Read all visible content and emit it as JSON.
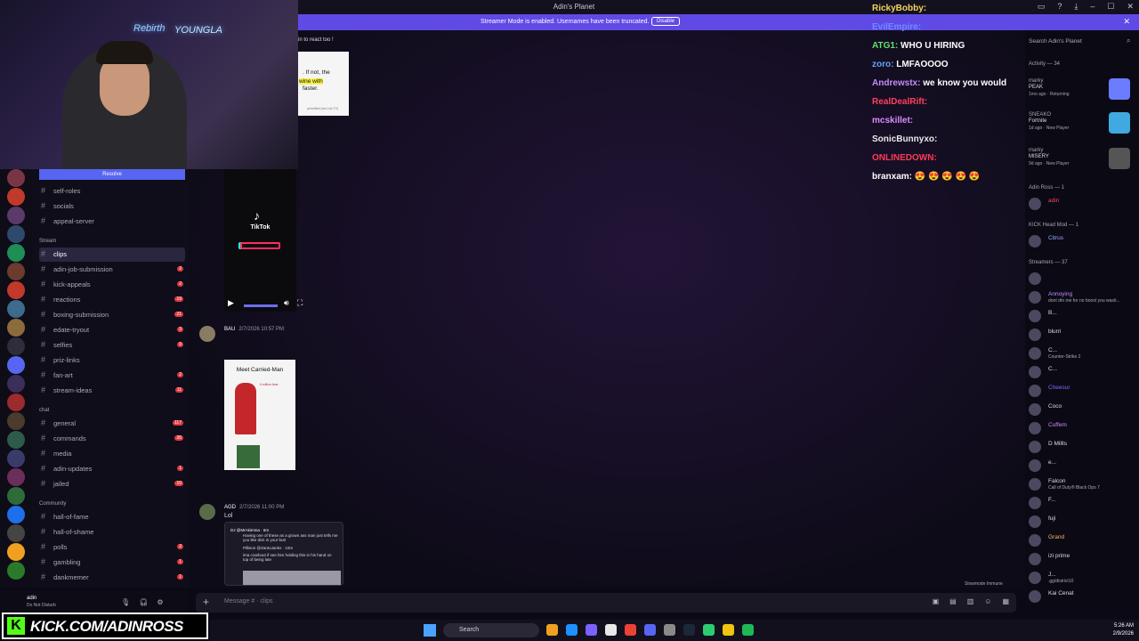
{
  "window": {
    "title": "Adin's Planet"
  },
  "banner": {
    "text": "Streamer Mode is enabled. Usernames have been truncated.",
    "button": "Disable"
  },
  "webcam": {
    "sign_left": "Rebirth",
    "sign_right": "YOUNGLA"
  },
  "sidebar": {
    "resolve": "Resolve",
    "categories": {
      "stream": "Stream",
      "chat": "chat",
      "community": "Community"
    },
    "channels": [
      {
        "name": "self-roles",
        "badge": ""
      },
      {
        "name": "socials",
        "badge": ""
      },
      {
        "name": "appeal-server",
        "badge": ""
      },
      {
        "name": "clips",
        "badge": ""
      },
      {
        "name": "adin-job-submission",
        "badge": "2"
      },
      {
        "name": "kick-appeals",
        "badge": "2"
      },
      {
        "name": "reactions",
        "badge": "19"
      },
      {
        "name": "boxing-submission",
        "badge": "21"
      },
      {
        "name": "edate-tryout",
        "badge": "3"
      },
      {
        "name": "selfies",
        "badge": "9"
      },
      {
        "name": "priz-links",
        "badge": ""
      },
      {
        "name": "fan-art",
        "badge": "2"
      },
      {
        "name": "stream-ideas",
        "badge": "11"
      },
      {
        "name": "general",
        "badge": "117"
      },
      {
        "name": "commands",
        "badge": "26"
      },
      {
        "name": "media",
        "badge": ""
      },
      {
        "name": "adin-updates",
        "badge": "1"
      },
      {
        "name": "jailed",
        "badge": "10"
      },
      {
        "name": "hall-of-fame",
        "badge": ""
      },
      {
        "name": "hall-of-shame",
        "badge": ""
      },
      {
        "name": "polls",
        "badge": "2"
      },
      {
        "name": "gambling",
        "badge": "1"
      },
      {
        "name": "dankmemer",
        "badge": "1"
      }
    ]
  },
  "user": {
    "name": "adin",
    "status": "Do Not Disturb"
  },
  "chat_overlay": [
    {
      "nick": "RickyBobby:",
      "msg": "",
      "color": "#f3d35c"
    },
    {
      "nick": "EvilEmpire:",
      "msg": "",
      "color": "#6f8cff"
    },
    {
      "nick": "ATG1:",
      "msg": "WHO U HIRING",
      "color": "#63e26a"
    },
    {
      "nick": "zoro:",
      "msg": "LMFAOOOO",
      "color": "#63a0ff"
    },
    {
      "nick": "Andrewstx:",
      "msg": "we know you would",
      "color": "#c58bff"
    },
    {
      "nick": "RealDealRift:",
      "msg": "",
      "color": "#ff4060"
    },
    {
      "nick": "mcskillet:",
      "msg": "",
      "color": "#d88bff"
    },
    {
      "nick": "SonicBunnyxo:",
      "msg": "",
      "color": "#e8e8e8"
    },
    {
      "nick": "ONLINEDOWN:",
      "msg": "",
      "color": "#ff3a57"
    },
    {
      "nick": "branxam:",
      "msg": "😍 😍 😍 😍 😍",
      "color": "#ffffff"
    }
  ],
  "feed": {
    "react_tip": "in to react too !",
    "popup": {
      "line1": ". If not, the",
      "line2": "wine with",
      "line3": "faster.",
      "line4": "permitted (via Lois TV)"
    },
    "tiktok": {
      "label": "TikTok"
    },
    "msg1": {
      "author": "BAU",
      "time": "2/7/2026 10:57 PM"
    },
    "meme": {
      "title": "Meet Carried-Man",
      "caption": "6 million fans"
    },
    "msg2": {
      "author": "AGD",
      "time": "2/7/2026 11:00 PM",
      "text": "Lol"
    },
    "tweet": {
      "handle": "DJ @MrAkimma · 6m",
      "text": "Having one of these as a grown ass man just tells me you like dick in your butt",
      "reply_handle": "Pillsion @ZantoJanks · 10m",
      "reply_text": "ima crashout if see him holding this in his hand on top of being late"
    },
    "slowmode": "Slowmode Immune"
  },
  "composer": {
    "placeholder": "Message # · clips"
  },
  "members": {
    "search": "Search Adin's Planet",
    "activity_header": "Activity — 34",
    "activities": [
      {
        "name": "marky",
        "game": "PEAK",
        "meta": "1mo ago · Returning"
      },
      {
        "name": "SNEAKO",
        "game": "Fortnite",
        "meta": "1d ago · New Player"
      },
      {
        "name": "marky",
        "game": "MISERY",
        "meta": "9d ago · New Player"
      }
    ],
    "sections": {
      "adin": "Adin Ross — 1",
      "kick": "KICK Head Mod — 1",
      "streamers": "Streamers — 37"
    },
    "list": [
      {
        "name": "adin",
        "sub": ""
      },
      {
        "name": "Citrus",
        "sub": ""
      },
      {
        "name": "",
        "sub": ""
      },
      {
        "name": "Annoying",
        "sub": "dont dm me for no boost you wasti..."
      },
      {
        "name": "B...",
        "sub": ""
      },
      {
        "name": "blurri",
        "sub": ""
      },
      {
        "name": "C...",
        "sub": "Counter-Strike 2"
      },
      {
        "name": "C...",
        "sub": ""
      },
      {
        "name": "Cheesur",
        "sub": ""
      },
      {
        "name": "Coco",
        "sub": ""
      },
      {
        "name": "Cuffem",
        "sub": ""
      },
      {
        "name": "D Millls",
        "sub": ""
      },
      {
        "name": "e...",
        "sub": ""
      },
      {
        "name": "Falcon",
        "sub": "Call of Duty® Black Ops 7"
      },
      {
        "name": "F...",
        "sub": ""
      },
      {
        "name": "fuji",
        "sub": ""
      },
      {
        "name": "Grand",
        "sub": ""
      },
      {
        "name": "izi prime",
        "sub": ""
      },
      {
        "name": "J...",
        "sub": ".gg/district10"
      },
      {
        "name": "Kai Cenat",
        "sub": ""
      }
    ]
  },
  "overlay_brand": {
    "url": "KICK.COM/ADINROSS",
    "logo": "K"
  },
  "taskbar": {
    "search": "Search",
    "time": "5:26 AM",
    "date": "2/9/2026"
  },
  "colors": {
    "accent": "#5865f2",
    "banner": "#5f4ae6",
    "kick": "#53fc18",
    "badge": "#e0383e"
  }
}
